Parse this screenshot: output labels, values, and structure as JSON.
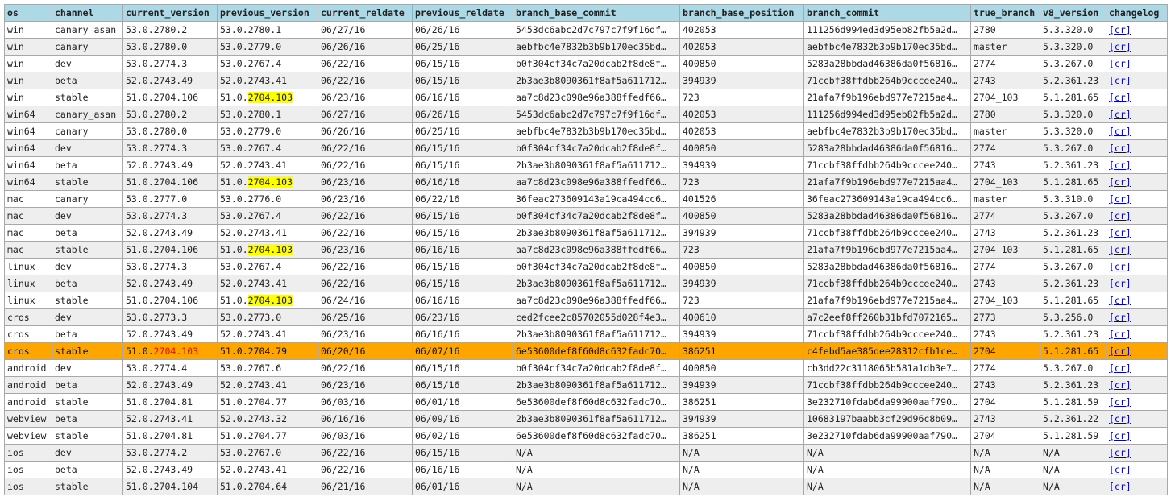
{
  "table": {
    "columns": [
      "os",
      "channel",
      "current_version",
      "previous_version",
      "current_reldate",
      "previous_reldate",
      "branch_base_commit",
      "branch_base_position",
      "branch_commit",
      "true_branch",
      "v8_version",
      "changelog"
    ],
    "rows": [
      {
        "os": "win",
        "channel": "canary_asan",
        "current_version": "53.0.2780.2",
        "previous_version": "53.0.2780.1",
        "current_reldate": "06/27/16",
        "previous_reldate": "06/26/16",
        "branch_base_commit": "5453dc6abc2d7c797c7f9f16df…",
        "branch_base_position": "402053",
        "branch_commit": "111256d994ed3d95eb82fb5a2d…",
        "true_branch": "2780",
        "v8_version": "5.3.320.0",
        "changelog": "[cr]"
      },
      {
        "os": "win",
        "channel": "canary",
        "current_version": "53.0.2780.0",
        "previous_version": "53.0.2779.0",
        "current_reldate": "06/26/16",
        "previous_reldate": "06/25/16",
        "branch_base_commit": "aebfbc4e7832b3b9b170ec35bd…",
        "branch_base_position": "402053",
        "branch_commit": "aebfbc4e7832b3b9b170ec35bd…",
        "true_branch": "master",
        "v8_version": "5.3.320.0",
        "changelog": "[cr]"
      },
      {
        "os": "win",
        "channel": "dev",
        "current_version": "53.0.2774.3",
        "previous_version": "53.0.2767.4",
        "current_reldate": "06/22/16",
        "previous_reldate": "06/15/16",
        "branch_base_commit": "b0f304cf34c7a20dcab2f8de8f…",
        "branch_base_position": "400850",
        "branch_commit": "5283a28bbdad46386da0f56816…",
        "true_branch": "2774",
        "v8_version": "5.3.267.0",
        "changelog": "[cr]"
      },
      {
        "os": "win",
        "channel": "beta",
        "current_version": "52.0.2743.49",
        "previous_version": "52.0.2743.41",
        "current_reldate": "06/22/16",
        "previous_reldate": "06/15/16",
        "branch_base_commit": "2b3ae3b8090361f8af5a611712…",
        "branch_base_position": "394939",
        "branch_commit": "71ccbf38ffdbb264b9cccee240…",
        "true_branch": "2743",
        "v8_version": "5.2.361.23",
        "changelog": "[cr]"
      },
      {
        "os": "win",
        "channel": "stable",
        "current_version": "51.0.2704.106",
        "previous_version": {
          "pre": "51.0.",
          "mark": "2704.103"
        },
        "current_reldate": "06/23/16",
        "previous_reldate": "06/16/16",
        "branch_base_commit": "aa7c8d23c098e96a388ffedf66…",
        "branch_base_position": "723",
        "branch_commit": "21afa7f9b196ebd977e7215aa4…",
        "true_branch": "2704_103",
        "v8_version": "5.1.281.65",
        "changelog": "[cr]"
      },
      {
        "os": "win64",
        "channel": "canary_asan",
        "current_version": "53.0.2780.2",
        "previous_version": "53.0.2780.1",
        "current_reldate": "06/27/16",
        "previous_reldate": "06/26/16",
        "branch_base_commit": "5453dc6abc2d7c797c7f9f16df…",
        "branch_base_position": "402053",
        "branch_commit": "111256d994ed3d95eb82fb5a2d…",
        "true_branch": "2780",
        "v8_version": "5.3.320.0",
        "changelog": "[cr]"
      },
      {
        "os": "win64",
        "channel": "canary",
        "current_version": "53.0.2780.0",
        "previous_version": "53.0.2779.0",
        "current_reldate": "06/26/16",
        "previous_reldate": "06/25/16",
        "branch_base_commit": "aebfbc4e7832b3b9b170ec35bd…",
        "branch_base_position": "402053",
        "branch_commit": "aebfbc4e7832b3b9b170ec35bd…",
        "true_branch": "master",
        "v8_version": "5.3.320.0",
        "changelog": "[cr]"
      },
      {
        "os": "win64",
        "channel": "dev",
        "current_version": "53.0.2774.3",
        "previous_version": "53.0.2767.4",
        "current_reldate": "06/22/16",
        "previous_reldate": "06/15/16",
        "branch_base_commit": "b0f304cf34c7a20dcab2f8de8f…",
        "branch_base_position": "400850",
        "branch_commit": "5283a28bbdad46386da0f56816…",
        "true_branch": "2774",
        "v8_version": "5.3.267.0",
        "changelog": "[cr]"
      },
      {
        "os": "win64",
        "channel": "beta",
        "current_version": "52.0.2743.49",
        "previous_version": "52.0.2743.41",
        "current_reldate": "06/22/16",
        "previous_reldate": "06/15/16",
        "branch_base_commit": "2b3ae3b8090361f8af5a611712…",
        "branch_base_position": "394939",
        "branch_commit": "71ccbf38ffdbb264b9cccee240…",
        "true_branch": "2743",
        "v8_version": "5.2.361.23",
        "changelog": "[cr]"
      },
      {
        "os": "win64",
        "channel": "stable",
        "current_version": "51.0.2704.106",
        "previous_version": {
          "pre": "51.0.",
          "mark": "2704.103"
        },
        "current_reldate": "06/23/16",
        "previous_reldate": "06/16/16",
        "branch_base_commit": "aa7c8d23c098e96a388ffedf66…",
        "branch_base_position": "723",
        "branch_commit": "21afa7f9b196ebd977e7215aa4…",
        "true_branch": "2704_103",
        "v8_version": "5.1.281.65",
        "changelog": "[cr]"
      },
      {
        "os": "mac",
        "channel": "canary",
        "current_version": "53.0.2777.0",
        "previous_version": "53.0.2776.0",
        "current_reldate": "06/23/16",
        "previous_reldate": "06/22/16",
        "branch_base_commit": "36feac273609143a19ca494cc6…",
        "branch_base_position": "401526",
        "branch_commit": "36feac273609143a19ca494cc6…",
        "true_branch": "master",
        "v8_version": "5.3.310.0",
        "changelog": "[cr]"
      },
      {
        "os": "mac",
        "channel": "dev",
        "current_version": "53.0.2774.3",
        "previous_version": "53.0.2767.4",
        "current_reldate": "06/22/16",
        "previous_reldate": "06/15/16",
        "branch_base_commit": "b0f304cf34c7a20dcab2f8de8f…",
        "branch_base_position": "400850",
        "branch_commit": "5283a28bbdad46386da0f56816…",
        "true_branch": "2774",
        "v8_version": "5.3.267.0",
        "changelog": "[cr]"
      },
      {
        "os": "mac",
        "channel": "beta",
        "current_version": "52.0.2743.49",
        "previous_version": "52.0.2743.41",
        "current_reldate": "06/22/16",
        "previous_reldate": "06/15/16",
        "branch_base_commit": "2b3ae3b8090361f8af5a611712…",
        "branch_base_position": "394939",
        "branch_commit": "71ccbf38ffdbb264b9cccee240…",
        "true_branch": "2743",
        "v8_version": "5.2.361.23",
        "changelog": "[cr]"
      },
      {
        "os": "mac",
        "channel": "stable",
        "current_version": "51.0.2704.106",
        "previous_version": {
          "pre": "51.0.",
          "mark": "2704.103"
        },
        "current_reldate": "06/23/16",
        "previous_reldate": "06/16/16",
        "branch_base_commit": "aa7c8d23c098e96a388ffedf66…",
        "branch_base_position": "723",
        "branch_commit": "21afa7f9b196ebd977e7215aa4…",
        "true_branch": "2704_103",
        "v8_version": "5.1.281.65",
        "changelog": "[cr]"
      },
      {
        "os": "linux",
        "channel": "dev",
        "current_version": "53.0.2774.3",
        "previous_version": "53.0.2767.4",
        "current_reldate": "06/22/16",
        "previous_reldate": "06/15/16",
        "branch_base_commit": "b0f304cf34c7a20dcab2f8de8f…",
        "branch_base_position": "400850",
        "branch_commit": "5283a28bbdad46386da0f56816…",
        "true_branch": "2774",
        "v8_version": "5.3.267.0",
        "changelog": "[cr]"
      },
      {
        "os": "linux",
        "channel": "beta",
        "current_version": "52.0.2743.49",
        "previous_version": "52.0.2743.41",
        "current_reldate": "06/22/16",
        "previous_reldate": "06/15/16",
        "branch_base_commit": "2b3ae3b8090361f8af5a611712…",
        "branch_base_position": "394939",
        "branch_commit": "71ccbf38ffdbb264b9cccee240…",
        "true_branch": "2743",
        "v8_version": "5.2.361.23",
        "changelog": "[cr]"
      },
      {
        "os": "linux",
        "channel": "stable",
        "current_version": "51.0.2704.106",
        "previous_version": {
          "pre": "51.0.",
          "mark": "2704.103"
        },
        "current_reldate": "06/24/16",
        "previous_reldate": "06/16/16",
        "branch_base_commit": "aa7c8d23c098e96a388ffedf66…",
        "branch_base_position": "723",
        "branch_commit": "21afa7f9b196ebd977e7215aa4…",
        "true_branch": "2704_103",
        "v8_version": "5.1.281.65",
        "changelog": "[cr]"
      },
      {
        "os": "cros",
        "channel": "dev",
        "current_version": "53.0.2773.3",
        "previous_version": "53.0.2773.0",
        "current_reldate": "06/25/16",
        "previous_reldate": "06/23/16",
        "branch_base_commit": "ced2fcee2c85702055d028f4e3…",
        "branch_base_position": "400610",
        "branch_commit": "a7c2eef8ff260b31bfd7072165…",
        "true_branch": "2773",
        "v8_version": "5.3.256.0",
        "changelog": "[cr]"
      },
      {
        "os": "cros",
        "channel": "beta",
        "current_version": "52.0.2743.49",
        "previous_version": "52.0.2743.41",
        "current_reldate": "06/23/16",
        "previous_reldate": "06/16/16",
        "branch_base_commit": "2b3ae3b8090361f8af5a611712…",
        "branch_base_position": "394939",
        "branch_commit": "71ccbf38ffdbb264b9cccee240…",
        "true_branch": "2743",
        "v8_version": "5.2.361.23",
        "changelog": "[cr]"
      },
      {
        "os": "cros",
        "channel": "stable",
        "current_version": {
          "pre": "51.0.",
          "mark": "2704.103"
        },
        "previous_version": "51.0.2704.79",
        "current_reldate": "06/20/16",
        "previous_reldate": "06/07/16",
        "branch_base_commit": "6e53600def8f60d8c632fadc70…",
        "branch_base_position": "386251",
        "branch_commit": "c4febd5ae385dee28312cfb1ce…",
        "true_branch": "2704",
        "v8_version": "5.1.281.65",
        "changelog": "[cr]",
        "highlight": true
      },
      {
        "os": "android",
        "channel": "dev",
        "current_version": "53.0.2774.4",
        "previous_version": "53.0.2767.6",
        "current_reldate": "06/22/16",
        "previous_reldate": "06/15/16",
        "branch_base_commit": "b0f304cf34c7a20dcab2f8de8f…",
        "branch_base_position": "400850",
        "branch_commit": "cb3dd22c3118065b581a1db3e7…",
        "true_branch": "2774",
        "v8_version": "5.3.267.0",
        "changelog": "[cr]"
      },
      {
        "os": "android",
        "channel": "beta",
        "current_version": "52.0.2743.49",
        "previous_version": "52.0.2743.41",
        "current_reldate": "06/23/16",
        "previous_reldate": "06/15/16",
        "branch_base_commit": "2b3ae3b8090361f8af5a611712…",
        "branch_base_position": "394939",
        "branch_commit": "71ccbf38ffdbb264b9cccee240…",
        "true_branch": "2743",
        "v8_version": "5.2.361.23",
        "changelog": "[cr]"
      },
      {
        "os": "android",
        "channel": "stable",
        "current_version": "51.0.2704.81",
        "previous_version": "51.0.2704.77",
        "current_reldate": "06/03/16",
        "previous_reldate": "06/01/16",
        "branch_base_commit": "6e53600def8f60d8c632fadc70…",
        "branch_base_position": "386251",
        "branch_commit": "3e232710fdab6da99900aaf790…",
        "true_branch": "2704",
        "v8_version": "5.1.281.59",
        "changelog": "[cr]"
      },
      {
        "os": "webview",
        "channel": "beta",
        "current_version": "52.0.2743.41",
        "previous_version": "52.0.2743.32",
        "current_reldate": "06/16/16",
        "previous_reldate": "06/09/16",
        "branch_base_commit": "2b3ae3b8090361f8af5a611712…",
        "branch_base_position": "394939",
        "branch_commit": "10683197baabb3cf29d96c8b09…",
        "true_branch": "2743",
        "v8_version": "5.2.361.22",
        "changelog": "[cr]"
      },
      {
        "os": "webview",
        "channel": "stable",
        "current_version": "51.0.2704.81",
        "previous_version": "51.0.2704.77",
        "current_reldate": "06/03/16",
        "previous_reldate": "06/02/16",
        "branch_base_commit": "6e53600def8f60d8c632fadc70…",
        "branch_base_position": "386251",
        "branch_commit": "3e232710fdab6da99900aaf790…",
        "true_branch": "2704",
        "v8_version": "5.1.281.59",
        "changelog": "[cr]"
      },
      {
        "os": "ios",
        "channel": "dev",
        "current_version": "53.0.2774.2",
        "previous_version": "53.0.2767.0",
        "current_reldate": "06/22/16",
        "previous_reldate": "06/15/16",
        "branch_base_commit": "N/A",
        "branch_base_position": "N/A",
        "branch_commit": "N/A",
        "true_branch": "N/A",
        "v8_version": "N/A",
        "changelog": "[cr]"
      },
      {
        "os": "ios",
        "channel": "beta",
        "current_version": "52.0.2743.49",
        "previous_version": "52.0.2743.41",
        "current_reldate": "06/22/16",
        "previous_reldate": "06/16/16",
        "branch_base_commit": "N/A",
        "branch_base_position": "N/A",
        "branch_commit": "N/A",
        "true_branch": "N/A",
        "v8_version": "N/A",
        "changelog": "[cr]"
      },
      {
        "os": "ios",
        "channel": "stable",
        "current_version": "51.0.2704.104",
        "previous_version": "51.0.2704.64",
        "current_reldate": "06/21/16",
        "previous_reldate": "06/01/16",
        "branch_base_commit": "N/A",
        "branch_base_position": "N/A",
        "branch_commit": "N/A",
        "true_branch": "N/A",
        "v8_version": "N/A",
        "changelog": "[cr]"
      }
    ]
  },
  "colors": {
    "header_bg": "#add8e6",
    "alt_row_bg": "#eeeeee",
    "highlight_row_bg": "#ffa500",
    "version_mark_bg": "#ffff00",
    "highlight_mark_text": "#ff0000",
    "link": "#0000cc",
    "border": "#a8a8a8"
  }
}
